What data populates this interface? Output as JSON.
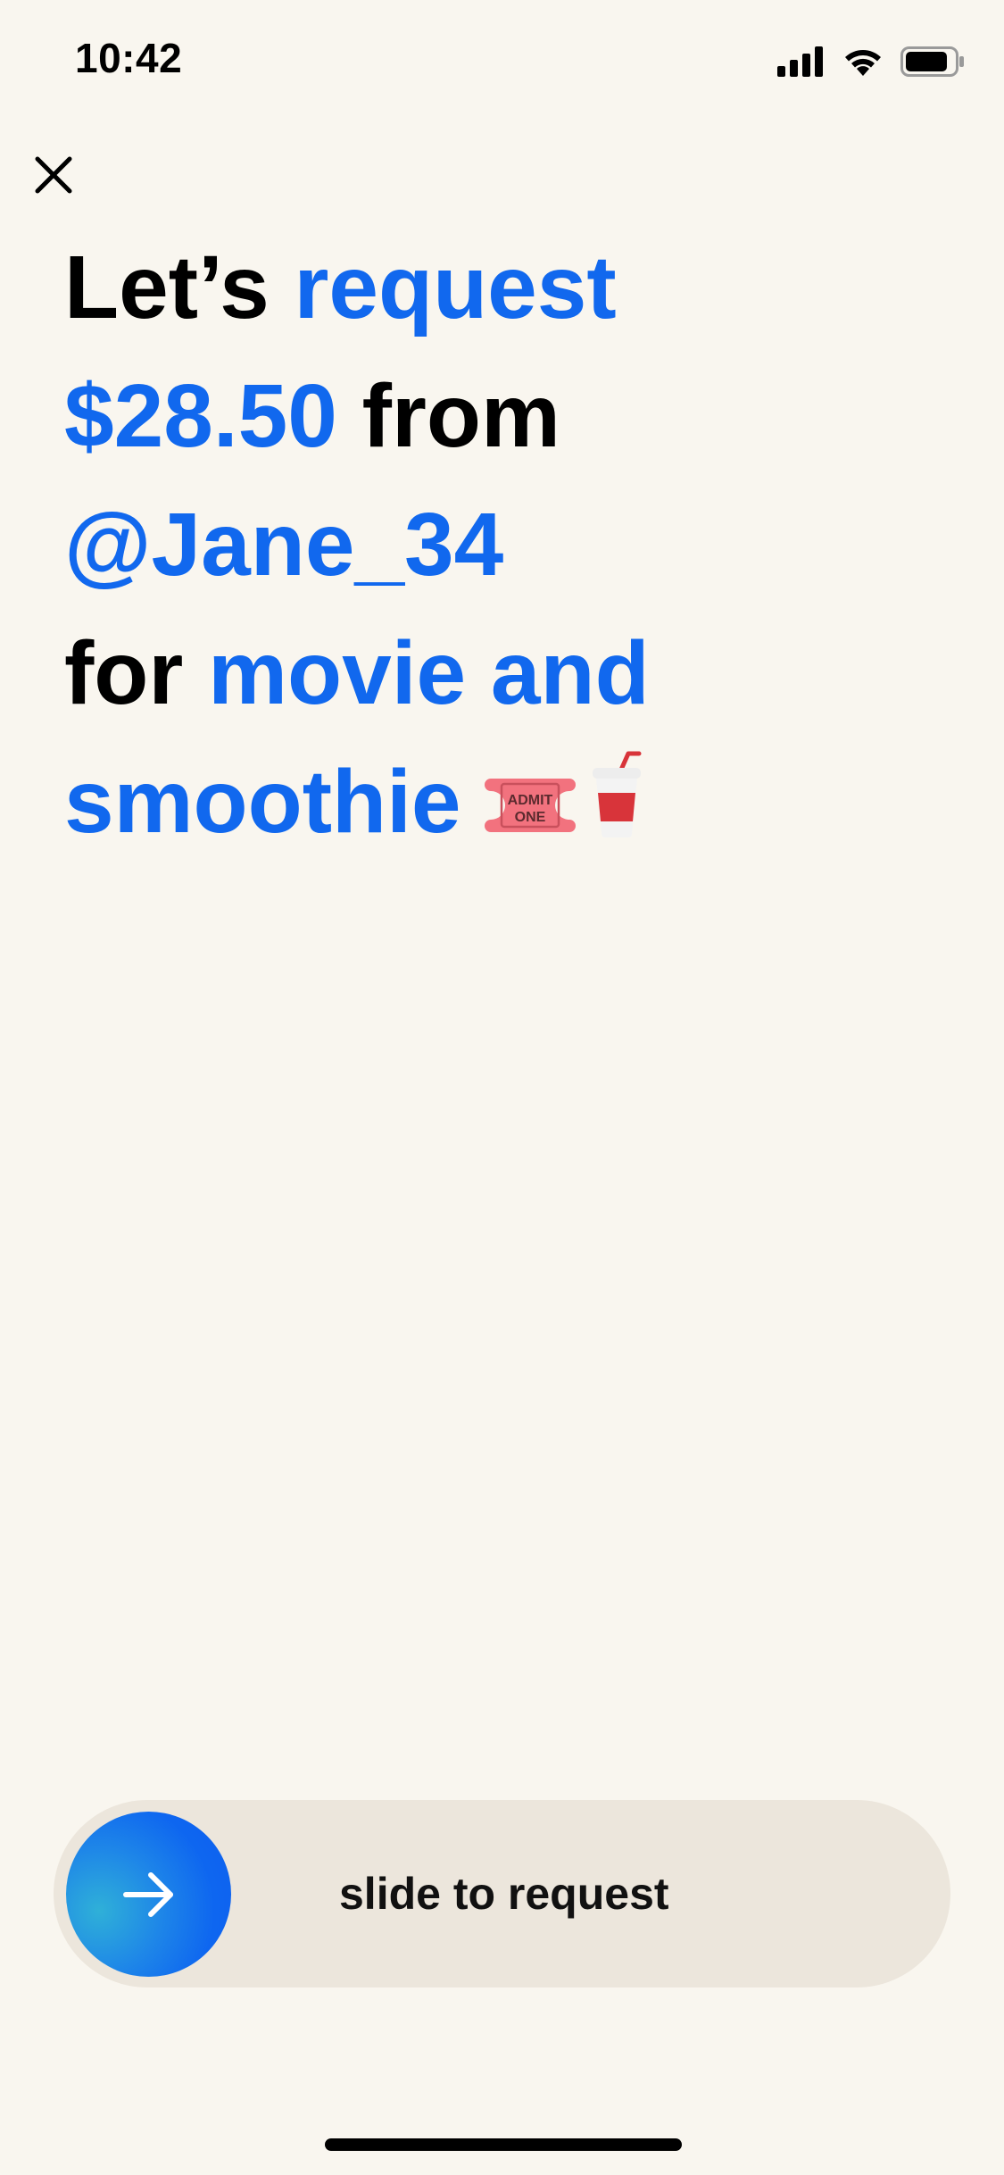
{
  "status_bar": {
    "time": "10:42",
    "icons": [
      "cellular-signal-icon",
      "wifi-icon",
      "battery-icon"
    ]
  },
  "close_button": {
    "icon": "close-icon"
  },
  "headline": {
    "line1": {
      "prefix": "Let’s",
      "highlight": "request"
    },
    "line2": {
      "amount": "$28.50",
      "suffix": "from"
    },
    "line3": {
      "recipient": "@Jane_34"
    },
    "line4": {
      "prefix": "for",
      "highlight": "movie and"
    },
    "line5": {
      "highlight": "smoothie"
    },
    "emojis": [
      "ticket-emoji-icon",
      "cup-with-straw-emoji-icon"
    ]
  },
  "slider": {
    "label": "slide to request",
    "knob_icon": "arrow-right-icon"
  },
  "colors": {
    "background": "#F9F6EF",
    "accent": "#1168EE",
    "track": "#ECE6DC",
    "text": "#000000"
  }
}
